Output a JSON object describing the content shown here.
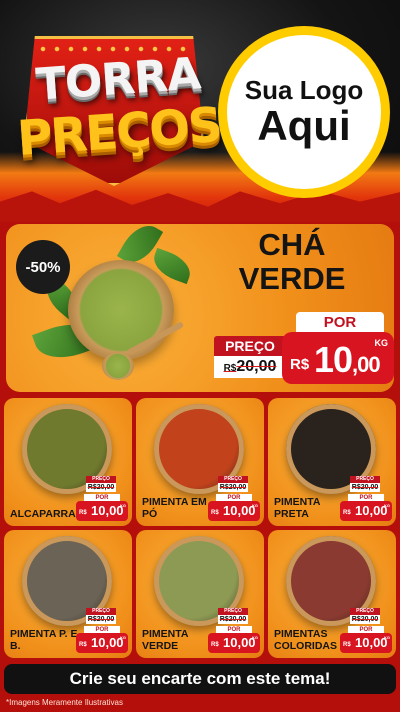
{
  "header": {
    "title_line1": "TORRA",
    "title_line2": "PREÇOS",
    "logo_line1": "Sua Logo",
    "logo_line2": "Aqui"
  },
  "hero": {
    "discount": "-50%",
    "product": "CHÁ VERDE",
    "old_label": "PREÇO",
    "old_currency": "R$",
    "old_value": "20,00",
    "por_label": "POR",
    "currency": "R$",
    "price_int": "10",
    "price_dec": ",00",
    "unit": "KG"
  },
  "products": [
    {
      "name": "ALCAPARRAS",
      "old_label": "PREÇO",
      "old_value": "R$20,00",
      "por": "POR",
      "currency": "R$",
      "price": "10,00",
      "unit": "KG",
      "bowl_color": "#6f7a2e"
    },
    {
      "name": "PIMENTA EM PÓ",
      "old_label": "PREÇO",
      "old_value": "R$20,00",
      "por": "POR",
      "currency": "R$",
      "price": "10,00",
      "unit": "KG",
      "bowl_color": "#c2421c"
    },
    {
      "name": "PIMENTA PRETA",
      "old_label": "PREÇO",
      "old_value": "R$20,00",
      "por": "POR",
      "currency": "R$",
      "price": "10,00",
      "unit": "KG",
      "bowl_color": "#2a221c"
    },
    {
      "name": "PIMENTA P. E B.",
      "old_label": "PREÇO",
      "old_value": "R$20,00",
      "por": "POR",
      "currency": "R$",
      "price": "10,00",
      "unit": "KG",
      "bowl_color": "#6b6456"
    },
    {
      "name": "PIMENTA VERDE",
      "old_label": "PREÇO",
      "old_value": "R$20,00",
      "por": "POR",
      "currency": "R$",
      "price": "10,00",
      "unit": "KG",
      "bowl_color": "#8c9a54"
    },
    {
      "name": "PIMENTAS COLORIDAS",
      "old_label": "PREÇO",
      "old_value": "R$20,00",
      "por": "POR",
      "currency": "R$",
      "price": "10,00",
      "unit": "KG",
      "bowl_color": "#8a3a30"
    }
  ],
  "footer": {
    "cta": "Crie seu encarte com este tema!",
    "disclaimer": "*Imagens Meramente Ilustrativas"
  }
}
